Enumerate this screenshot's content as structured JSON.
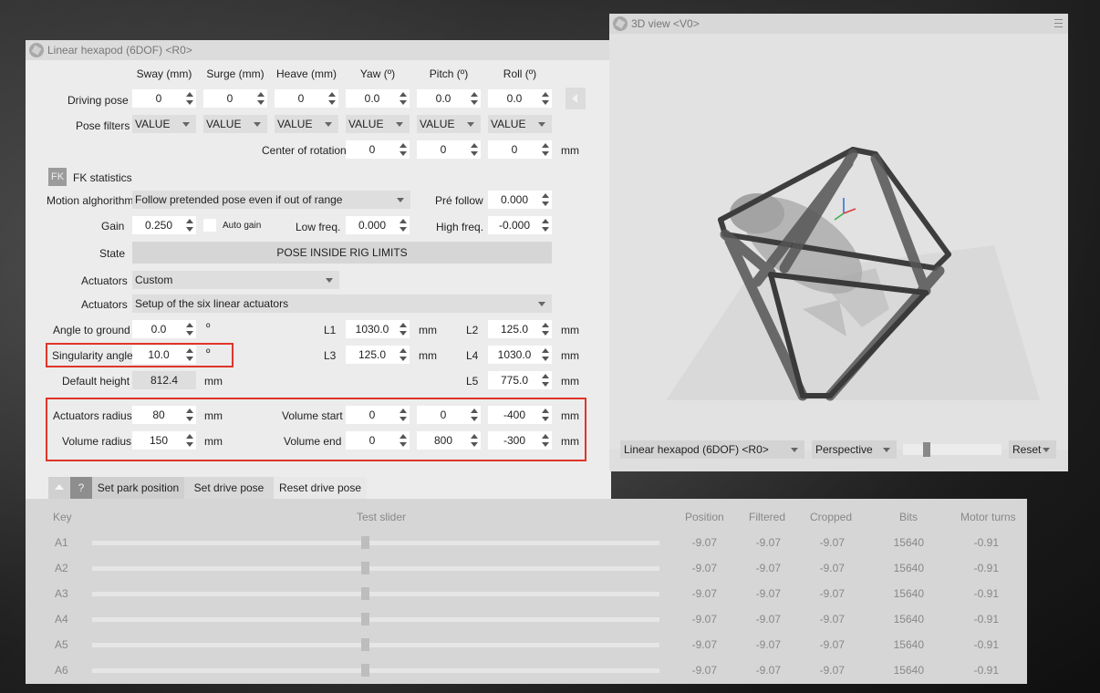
{
  "main_window": {
    "title": "Linear hexapod (6DOF) <R0>",
    "columns": [
      "Sway (mm)",
      "Surge (mm)",
      "Heave (mm)",
      "Yaw (º)",
      "Pitch (º)",
      "Roll (º)"
    ],
    "driving_pose": {
      "label": "Driving pose",
      "values": [
        "0",
        "0",
        "0",
        "0.0",
        "0.0",
        "0.0"
      ]
    },
    "pose_filters": {
      "label": "Pose filters",
      "values": [
        "VALUE",
        "VALUE",
        "VALUE",
        "VALUE",
        "VALUE",
        "VALUE"
      ]
    },
    "center_of_rotation": {
      "label": "Center of rotation",
      "values": [
        "0",
        "0",
        "0"
      ],
      "unit": "mm"
    },
    "fk": {
      "badge": "FK",
      "label": "FK statistics"
    },
    "motion": {
      "label": "Motion alghorithm",
      "value": "Follow pretended pose even if out of range",
      "pre_follow_label": "Pré follow",
      "pre_follow_value": "0.000"
    },
    "gain": {
      "label": "Gain",
      "value": "0.250",
      "auto_gain_label": "Auto gain",
      "low_freq_label": "Low freq.",
      "low_freq_value": "0.000",
      "high_freq_label": "High freq.",
      "high_freq_value": "-0.000"
    },
    "state": {
      "label": "State",
      "value": "POSE INSIDE RIG LIMITS"
    },
    "actuators_type": {
      "label": "Actuators",
      "value": "Custom"
    },
    "actuators_setup": {
      "label": "Actuators",
      "value": "Setup of the six linear actuators"
    },
    "angle_to_ground": {
      "label": "Angle to ground",
      "value": "0.0",
      "unit": "º"
    },
    "singularity_angle": {
      "label": "Singularity angle",
      "value": "10.0",
      "unit": "º"
    },
    "default_height": {
      "label": "Default height",
      "value": "812.4",
      "unit": "mm"
    },
    "lengths": {
      "L1": {
        "label": "L1",
        "value": "1030.0",
        "unit": "mm"
      },
      "L2": {
        "label": "L2",
        "value": "125.0",
        "unit": "mm"
      },
      "L3": {
        "label": "L3",
        "value": "125.0",
        "unit": "mm"
      },
      "L4": {
        "label": "L4",
        "value": "1030.0",
        "unit": "mm"
      },
      "L5": {
        "label": "L5",
        "value": "775.0",
        "unit": "mm"
      }
    },
    "actuators_radius": {
      "label": "Actuators radius",
      "value": "80",
      "unit": "mm"
    },
    "volume_radius": {
      "label": "Volume radius",
      "value": "150",
      "unit": "mm"
    },
    "volume_start": {
      "label": "Volume start",
      "values": [
        "0",
        "0",
        "-400"
      ],
      "unit": "mm"
    },
    "volume_end": {
      "label": "Volume end",
      "values": [
        "0",
        "800",
        "-300"
      ],
      "unit": "mm"
    }
  },
  "toolbar": {
    "help_label": "?",
    "set_park_label": "Set park position",
    "set_drive_label": "Set drive pose",
    "reset_drive_label": "Reset drive pose"
  },
  "table": {
    "headers": {
      "key": "Key",
      "test_slider": "Test slider",
      "position": "Position",
      "filtered": "Filtered",
      "cropped": "Cropped",
      "bits": "Bits",
      "motor_turns": "Motor turns"
    },
    "rows": [
      {
        "key": "A1",
        "position": "-9.07",
        "filtered": "-9.07",
        "cropped": "-9.07",
        "bits": "15640",
        "motor_turns": "-0.91"
      },
      {
        "key": "A2",
        "position": "-9.07",
        "filtered": "-9.07",
        "cropped": "-9.07",
        "bits": "15640",
        "motor_turns": "-0.91"
      },
      {
        "key": "A3",
        "position": "-9.07",
        "filtered": "-9.07",
        "cropped": "-9.07",
        "bits": "15640",
        "motor_turns": "-0.91"
      },
      {
        "key": "A4",
        "position": "-9.07",
        "filtered": "-9.07",
        "cropped": "-9.07",
        "bits": "15640",
        "motor_turns": "-0.91"
      },
      {
        "key": "A5",
        "position": "-9.07",
        "filtered": "-9.07",
        "cropped": "-9.07",
        "bits": "15640",
        "motor_turns": "-0.91"
      },
      {
        "key": "A6",
        "position": "-9.07",
        "filtered": "-9.07",
        "cropped": "-9.07",
        "bits": "15640",
        "motor_turns": "-0.91"
      }
    ]
  },
  "view_window": {
    "title": "3D view <V0>",
    "rig_select": "Linear hexapod (6DOF) <R0>",
    "projection_select": "Perspective",
    "reset_select": "Reset"
  },
  "colors": {
    "highlight": "#e0352b",
    "panel": "#ececec",
    "table_bg": "#d6d6d6"
  },
  "icons": [
    "app-logo-icon",
    "menu-icon",
    "chevron-left-icon",
    "chevron-up-icon",
    "help-icon"
  ]
}
